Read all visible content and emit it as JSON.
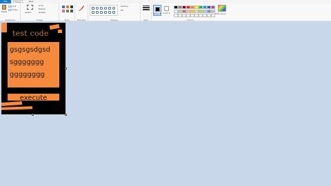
{
  "tabs": [
    "File",
    "Home",
    "View"
  ],
  "ribbon": {
    "clipboard": {
      "paste": "Paste",
      "cut": "Cut",
      "copy": "Copy",
      "label": "Clipboard"
    },
    "image": {
      "select": "Select",
      "crop": "Crop",
      "resize": "Resize",
      "rotate": "Rotate",
      "label": "Image"
    },
    "tools": {
      "label": "Tools"
    },
    "brushes": {
      "label": "Brushes"
    },
    "shapes": {
      "outline": "Outline",
      "fill": "Fill",
      "label": "Shapes"
    },
    "size": {
      "label": "Size"
    },
    "colors": {
      "color1": "Color 1",
      "color2": "Color 2",
      "edit": "Edit colors",
      "label": "Colors"
    }
  },
  "palette": [
    "#000000",
    "#7f7f7f",
    "#880015",
    "#ed1c24",
    "#ff7f27",
    "#fff200",
    "#22b14c",
    "#00a2e8",
    "#3f48cc",
    "#a349a4",
    "#ffffff",
    "#c3c3c3",
    "#b97a57",
    "#ffaec9",
    "#ffc90e",
    "#efe4b0",
    "#b5e61d",
    "#99d9ea",
    "#7092be",
    "#c8bfe7",
    "#ffffff",
    "#ffffff",
    "#ffffff",
    "#ffffff",
    "#ffffff",
    "#ffffff",
    "#ffffff",
    "#ffffff",
    "#ffffff",
    "#ffffff"
  ],
  "canvas": {
    "title": "test code",
    "lines": [
      "gsgsgsdgsd",
      "sggggggg",
      "gggggggg"
    ],
    "execute": "execute"
  }
}
